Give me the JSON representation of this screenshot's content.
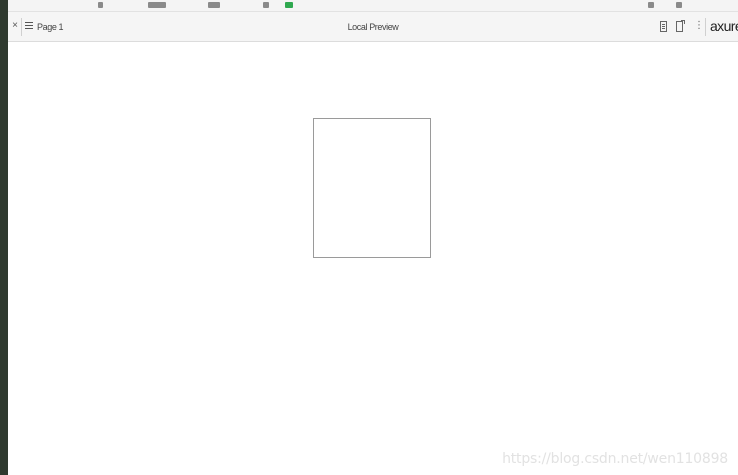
{
  "toolbar": {
    "close_glyph": "×",
    "page_name": "Page 1",
    "title": "Local Preview",
    "more_glyph": "⋮",
    "logo": "axure",
    "icons": [
      "pages-list-icon",
      "notes-icon",
      "inspect-icon",
      "more-options-icon"
    ]
  },
  "canvas": {
    "widgets": [
      {
        "type": "rectangle",
        "fill": "#ffffff",
        "stroke": "#9a9a9a"
      }
    ]
  },
  "watermark": "https://blog.csdn.net/wen110898",
  "colors": {
    "toolbar_bg": "#f5f5f5",
    "canvas_bg": "#ffffff",
    "left_edge": "#2f3a2f"
  }
}
